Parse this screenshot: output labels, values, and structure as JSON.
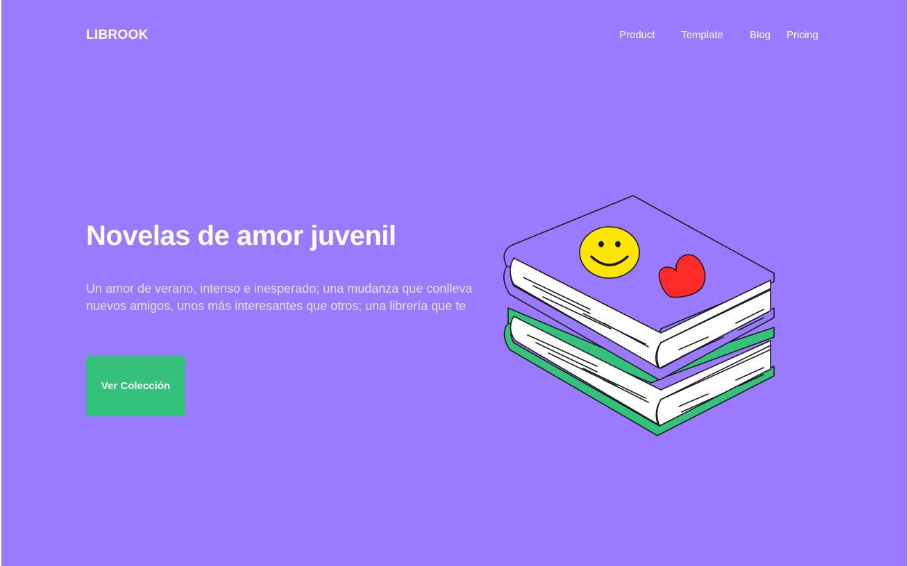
{
  "header": {
    "logo": "LIBROOK",
    "nav": [
      "Product",
      "Template",
      "Blog",
      "Pricing"
    ]
  },
  "hero": {
    "title": "Novelas de amor juvenil",
    "description": "Un amor de verano, intenso e inesperado; una mudanza que conlleva nuevos amigos, unos más interesantes que otros; una librería que te",
    "cta_label": "Ver Colección"
  },
  "illustration": {
    "icons": [
      "books-stack-icon",
      "smiley-face-icon",
      "heart-icon"
    ]
  },
  "colors": {
    "background": "#9a7bff",
    "accent": "#33c17c",
    "top_book": "#9a7bff",
    "bottom_book": "#33c17c",
    "smiley": "#ffe600",
    "heart": "#ff2a2a"
  }
}
